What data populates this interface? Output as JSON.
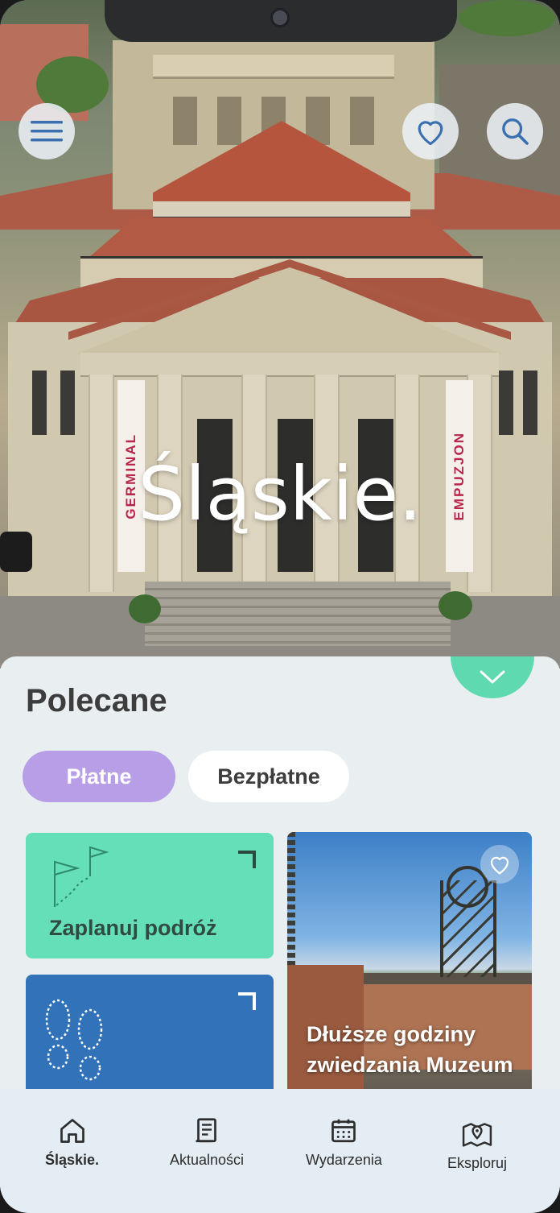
{
  "hero": {
    "title": "Śląskie.",
    "banner_left": "GERMINAL",
    "banner_right": "EMPUZJON"
  },
  "header": {
    "menu_icon": "hamburger-menu-icon",
    "favorites_icon": "heart-icon",
    "search_icon": "search-icon"
  },
  "section": {
    "title": "Polecane",
    "collapse_icon": "chevron-down-icon"
  },
  "filters": {
    "paid_label": "Płatne",
    "free_label": "Bezpłatne",
    "active": "Płatne"
  },
  "cards": {
    "plan": {
      "label": "Zaplanuj podróż",
      "icon": "flags-icon"
    },
    "walk": {
      "icon": "footprints-icon"
    },
    "museum": {
      "title": "Dłuższe godziny zwiedzania Muzeum",
      "icon": "heart-icon"
    }
  },
  "bottom_nav": {
    "items": [
      {
        "label": "Śląskie.",
        "icon": "home-icon",
        "active": true
      },
      {
        "label": "Aktualności",
        "icon": "news-icon",
        "active": false
      },
      {
        "label": "Wydarzenia",
        "icon": "calendar-icon",
        "active": false
      },
      {
        "label": "Eksploruj",
        "icon": "map-pin-icon",
        "active": false
      }
    ]
  },
  "colors": {
    "accent_mint": "#5fd9b0",
    "pill_active": "#b79ee6",
    "card_green": "#65dfb7",
    "card_blue": "#3272b8",
    "text_dark": "#3d3d3d"
  }
}
